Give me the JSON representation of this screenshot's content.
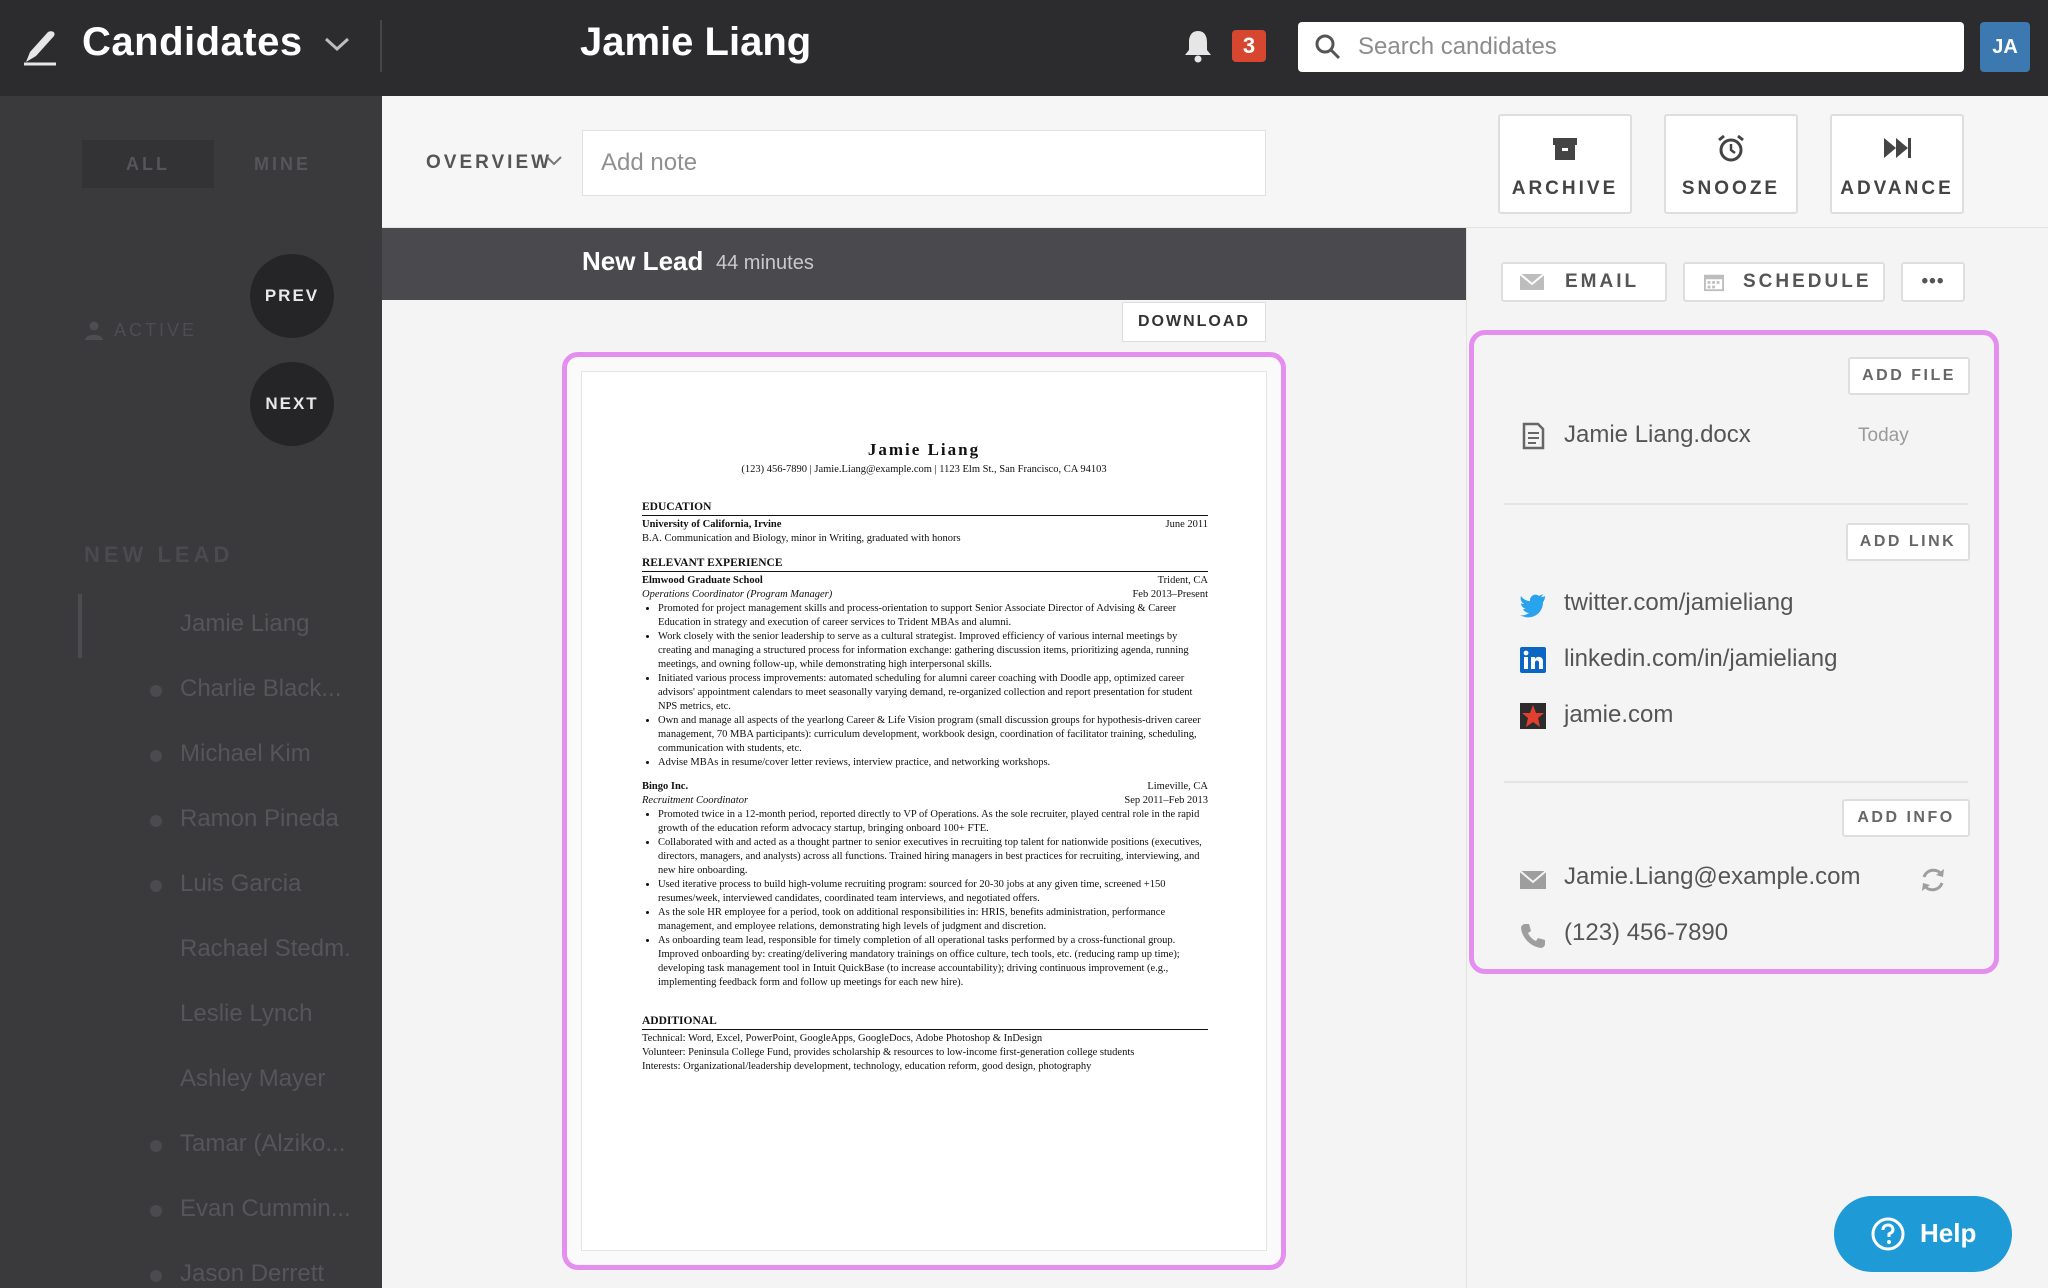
{
  "header": {
    "section_title": "Candidates",
    "candidate_name": "Jamie Liang",
    "notification_count": "3",
    "search_placeholder": "Search candidates",
    "avatar_initials": "JA"
  },
  "sidebar": {
    "tabs": [
      {
        "label": "ALL"
      },
      {
        "label": "MINE"
      }
    ],
    "filter_label": "ACTIVE",
    "prev_label": "PREV",
    "next_label": "NEXT",
    "section_label": "NEW LEAD",
    "candidates": [
      {
        "name": "Jamie Liang"
      },
      {
        "name": "Charlie Black..."
      },
      {
        "name": "Michael Kim"
      },
      {
        "name": "Ramon Pineda"
      },
      {
        "name": "Luis Garcia"
      },
      {
        "name": "Rachael Stedm..."
      },
      {
        "name": "Leslie Lynch"
      },
      {
        "name": "Ashley Mayer"
      },
      {
        "name": "Tamar (Alziko..."
      },
      {
        "name": "Evan Cummin..."
      },
      {
        "name": "Jason Derrett"
      }
    ]
  },
  "toolbar": {
    "overview_label": "OVERVIEW",
    "note_placeholder": "Add note",
    "archive_label": "ARCHIVE",
    "snooze_label": "SNOOZE",
    "advance_label": "ADVANCE"
  },
  "stage": {
    "name": "New Lead",
    "time": "44 minutes"
  },
  "resume": {
    "download_label": "DOWNLOAD",
    "name": "Jamie Liang",
    "contact": "(123) 456-7890 | Jamie.Liang@example.com | 1123 Elm St., San Francisco, CA 94103",
    "education_head": "EDUCATION",
    "edu_school": "University of California, Irvine",
    "edu_date": "June 2011",
    "edu_degree": "B.A. Communication and Biology, minor in Writing, graduated with honors",
    "experience_head": "RELEVANT EXPERIENCE",
    "job1_org": "Elmwood Graduate School",
    "job1_loc": "Trident, CA",
    "job1_title": "Operations Coordinator (Program Manager)",
    "job1_date": "Feb 2013–Present",
    "job1_bullets": [
      "Promoted for project management skills and process-orientation to support Senior Associate Director of Advising & Career Education in strategy and execution of career services to Trident MBAs and alumni.",
      "Work closely with the senior leadership to serve as a cultural strategist. Improved efficiency of various internal meetings by creating and managing a structured process for information exchange: gathering discussion items, prioritizing agenda, running meetings, and owning follow-up, while demonstrating high interpersonal skills.",
      "Initiated various process improvements: automated scheduling for alumni career coaching with Doodle app, optimized career advisors' appointment calendars to meet seasonally varying demand, re-organized collection and report presentation for student NPS metrics, etc.",
      "Own and manage all aspects of the yearlong Career & Life Vision program (small discussion groups for hypothesis-driven career management, 70 MBA participants): curriculum development, workbook design, coordination of facilitator training, scheduling, communication with students, etc.",
      "Advise MBAs in resume/cover letter reviews, interview practice, and networking workshops."
    ],
    "job2_org": "Bingo Inc.",
    "job2_loc": "Limeville, CA",
    "job2_title": "Recruitment Coordinator",
    "job2_date": "Sep 2011–Feb 2013",
    "job2_bullets": [
      "Promoted twice in a 12-month period, reported directly to VP of Operations. As the sole recruiter, played central role in the rapid growth of the education reform advocacy startup, bringing onboard 100+ FTE.",
      "Collaborated with and acted as a thought partner to senior executives in recruiting top talent for nationwide positions (executives, directors, managers, and analysts) across all functions. Trained hiring managers in best practices for recruiting, interviewing, and new hire onboarding.",
      "Used iterative process to build high-volume recruiting program: sourced for 20-30 jobs at any given time, screened +150 resumes/week, interviewed candidates, coordinated team interviews, and negotiated offers.",
      "As the sole HR employee for a period, took on additional responsibilities in: HRIS, benefits administration, performance management, and employee relations, demonstrating high levels of judgment and discretion.",
      "As onboarding team lead, responsible for timely completion of all operational tasks performed by a cross-functional group. Improved onboarding by: creating/delivering mandatory trainings on office culture, tech tools, etc. (reducing ramp up time); developing task management tool in Intuit QuickBase (to increase accountability); driving continuous improvement (e.g., implementing feedback form and follow up meetings for each new hire)."
    ],
    "additional_head": "ADDITIONAL",
    "additional_lines": [
      "Technical: Word, Excel, PowerPoint, GoogleApps, GoogleDocs, Adobe Photoshop & InDesign",
      "Volunteer: Peninsula College Fund, provides scholarship & resources to low-income first-generation college students",
      "Interests: Organizational/leadership development, technology, education reform, good design, photography"
    ]
  },
  "right_panel": {
    "email_label": "EMAIL",
    "schedule_label": "SCHEDULE",
    "more_label": "•••",
    "add_file_label": "ADD FILE",
    "file_name": "Jamie Liang.docx",
    "file_date": "Today",
    "add_link_label": "ADD LINK",
    "links": [
      {
        "text": "twitter.com/jamieliang",
        "icon": "twitter-icon"
      },
      {
        "text": "linkedin.com/in/jamieliang",
        "icon": "linkedin-icon"
      },
      {
        "text": "jamie.com",
        "icon": "website-star-icon"
      }
    ],
    "add_info_label": "ADD INFO",
    "email": "Jamie.Liang@example.com",
    "phone": "(123) 456-7890"
  },
  "help": {
    "label": "Help"
  },
  "colors": {
    "topbar": "#2c2c2e",
    "sidebar": "#3a3a3d",
    "highlight": "#e48ef0",
    "help": "#1e9ad6",
    "badge": "#d7472f",
    "avatar": "#3c79b0"
  }
}
